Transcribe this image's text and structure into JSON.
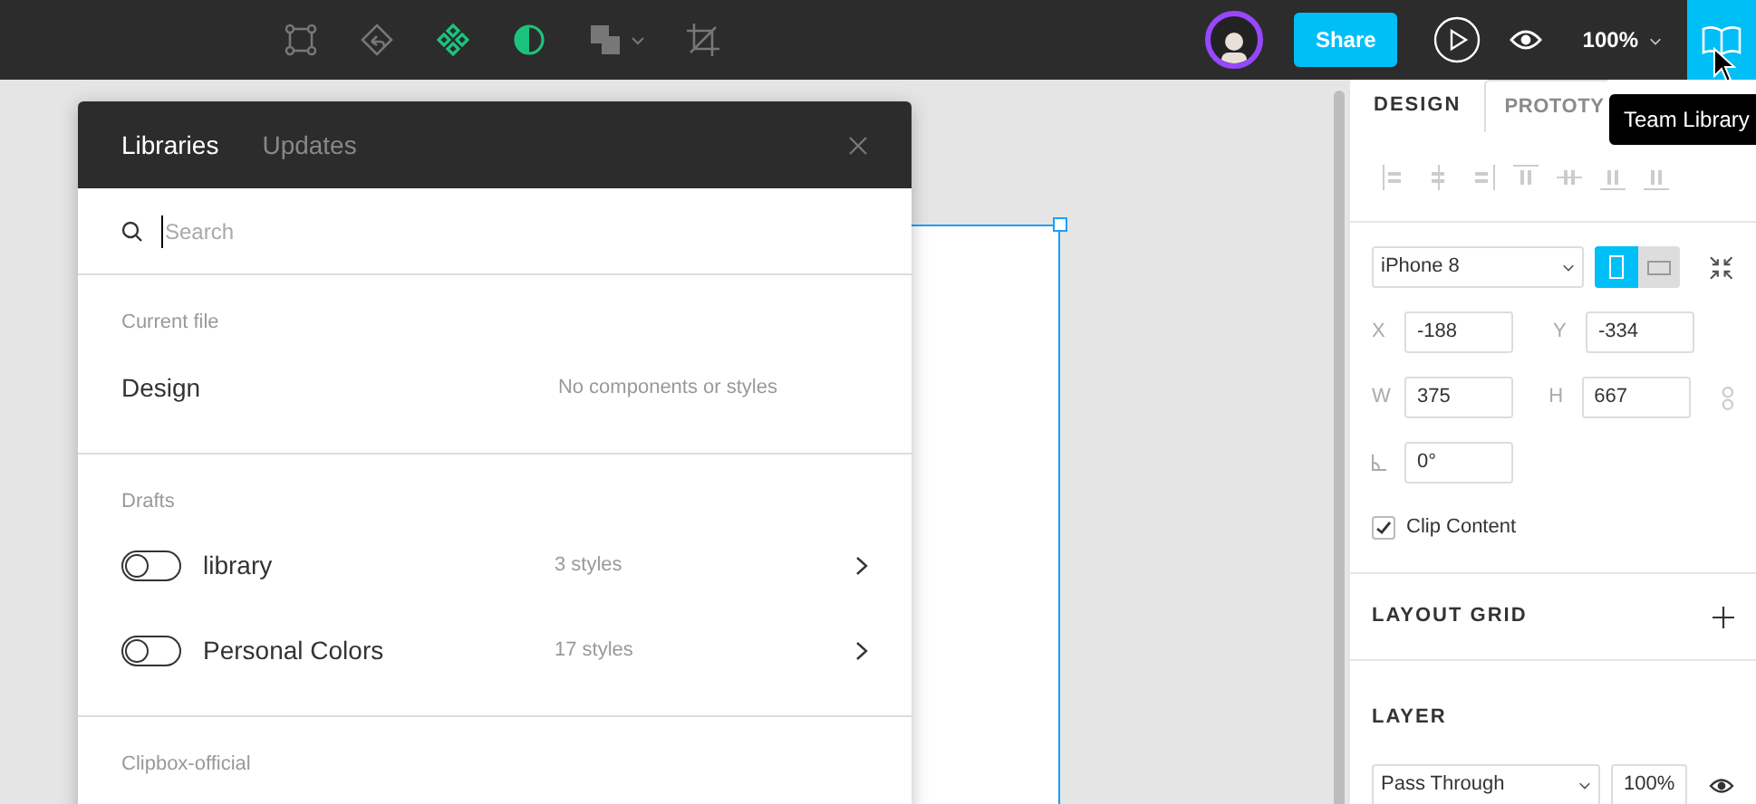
{
  "toolbar": {
    "zoom": "100%",
    "share": "Share",
    "tooltip": "Team Library"
  },
  "library_dialog": {
    "tabs": [
      {
        "label": "Libraries",
        "selected": true
      },
      {
        "label": "Updates",
        "selected": false
      }
    ],
    "search": {
      "placeholder": "Search"
    },
    "sections": [
      {
        "title": "Current file",
        "items": [
          {
            "kind": "file",
            "name": "Design",
            "info": "No components or styles"
          }
        ]
      },
      {
        "title": "Drafts",
        "items": [
          {
            "kind": "library",
            "name": "library",
            "info": "3 styles",
            "on": false
          },
          {
            "kind": "library",
            "name": "Personal Colors",
            "info": "17 styles",
            "on": false
          }
        ]
      },
      {
        "title": "Clipbox-official"
      }
    ]
  },
  "panel": {
    "tabs": [
      {
        "label": "DESIGN",
        "selected": true
      },
      {
        "label": "PROTOTY",
        "selected": false
      }
    ],
    "frame": {
      "preset": "iPhone 8",
      "orientation": [
        {
          "selected": true
        },
        {
          "selected": false
        }
      ]
    },
    "fields": [
      {
        "label": "X",
        "value": "-188"
      },
      {
        "label": "Y",
        "value": "-334"
      },
      {
        "label": "W",
        "value": "375"
      },
      {
        "label": "H",
        "value": "667"
      }
    ],
    "rotation": "0°",
    "clip_content": {
      "label": "Clip Content",
      "checked": true
    },
    "layout_grid": "LAYOUT GRID",
    "layer": {
      "title": "LAYER",
      "blend": "Pass Through",
      "opacity": "100%"
    }
  }
}
